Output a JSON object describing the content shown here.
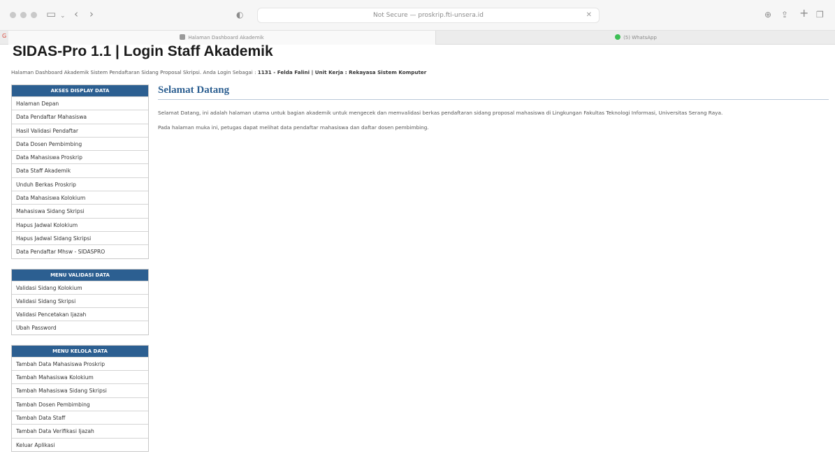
{
  "browser": {
    "url_text": "Not Secure — proskrip.fti-unsera.id",
    "tabs": [
      {
        "label": "Halaman Dashboard Akademik",
        "active": true
      },
      {
        "label": "(5) WhatsApp",
        "active": false
      }
    ]
  },
  "header": {
    "title": "SIDAS-Pro 1.1 | Login Staff Akademik",
    "subtitle_prefix": "Halaman Dashboard Akademik Sistem Pendaftaran Sidang Proposal Skripsi. Anda Login Sebagai :",
    "user_info": "1131 - Felda Falini | Unit Kerja : Rekayasa Sistem Komputer"
  },
  "sidebar": {
    "menus": [
      {
        "title": "AKSES DISPLAY DATA",
        "items": [
          "Halaman Depan",
          "Data Pendaftar Mahasiswa",
          "Hasil Validasi Pendaftar",
          "Data Dosen Pembimbing",
          "Data Mahasiswa Proskrip",
          "Data Staff Akademik",
          "Unduh Berkas Proskrip",
          "Data Mahasiswa Kolokium",
          "Mahasiswa Sidang Skripsi",
          "Hapus Jadwal Kolokium",
          "Hapus Jadwal Sidang Skripsi",
          "Data Pendaftar Mhsw - SIDASPRO"
        ]
      },
      {
        "title": "MENU VALIDASI DATA",
        "items": [
          "Validasi Sidang Kolokium",
          "Validasi Sidang Skripsi",
          "Validasi Pencetakan Ijazah",
          "Ubah Password"
        ]
      },
      {
        "title": "MENU KELOLA DATA",
        "items": [
          "Tambah Data Mahasiswa Proskrip",
          "Tambah Mahasiswa Kolokium",
          "Tambah Mahasiswa Sidang Skripsi",
          "Tambah Dosen Pembimbing",
          "Tambah Data Staff",
          "Tambah Data Verifikasi Ijazah",
          "Keluar Aplikasi"
        ]
      }
    ]
  },
  "main": {
    "heading": "Selamat Datang",
    "paragraphs": [
      "Selamat Datang, ini adalah halaman utama untuk bagian akademik untuk mengecek dan memvalidasi berkas pendaftaran sidang proposal mahasiswa di Lingkungan Fakultas Teknologi Informasi, Universitas Serang Raya.",
      "Pada halaman muka ini, petugas dapat melihat data pendaftar mahasiswa dan daftar dosen pembimbing."
    ]
  },
  "colors": {
    "menu_header": "#2c5f91",
    "heading": "#2c5f91"
  }
}
